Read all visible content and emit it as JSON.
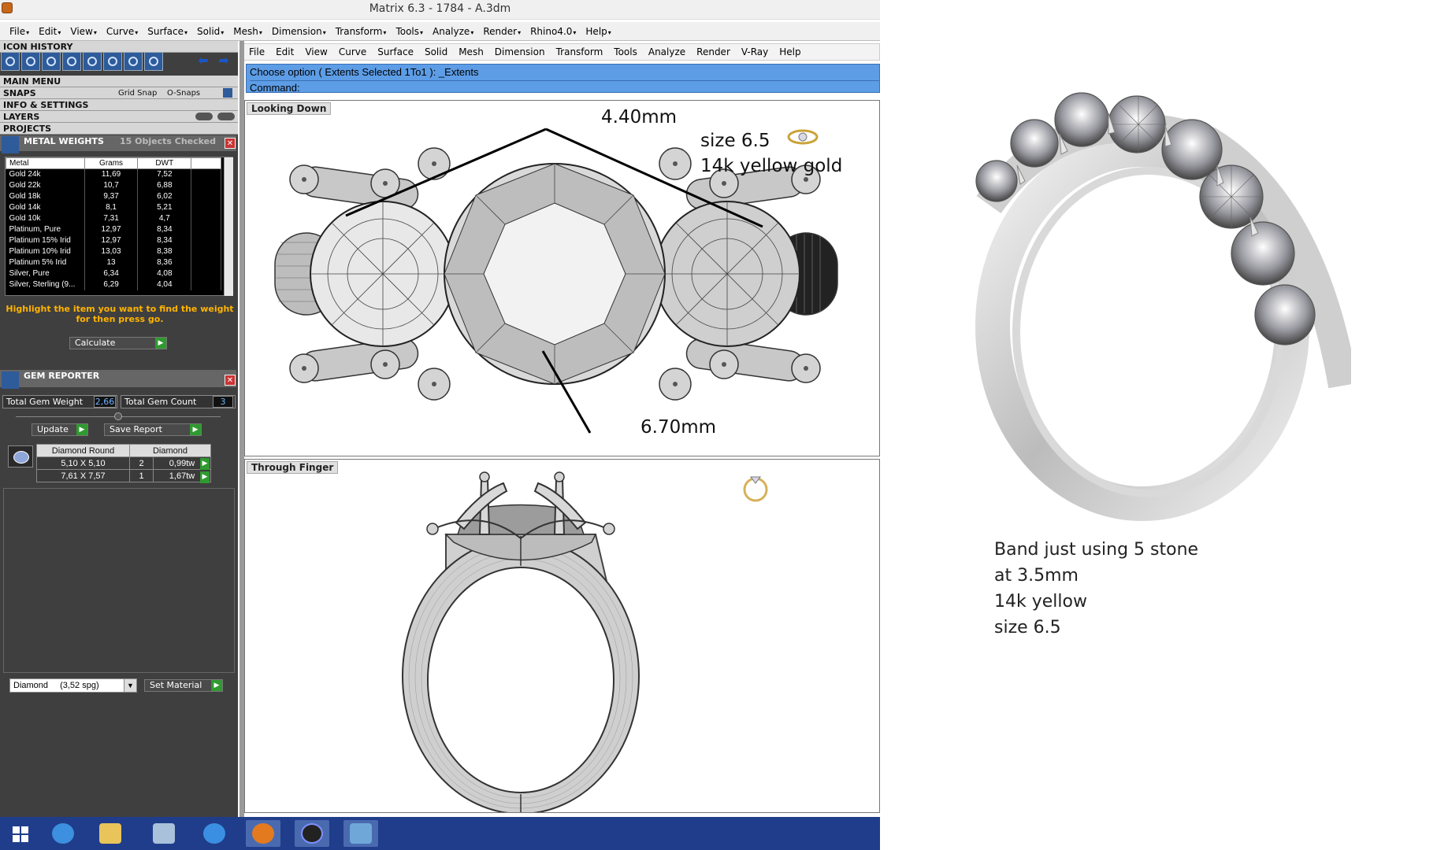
{
  "window": {
    "title": "Matrix 6.3 - 1784 - A.3dm"
  },
  "menubar": [
    "File",
    "Edit",
    "View",
    "Curve",
    "Surface",
    "Solid",
    "Mesh",
    "Dimension",
    "Transform",
    "Tools",
    "Analyze",
    "Render",
    "Rhino4.0",
    "Help"
  ],
  "sidebar": {
    "icon_history": "ICON HISTORY",
    "main_menu": "MAIN MENU",
    "snaps": "SNAPS",
    "grid_snap": "Grid Snap",
    "o_snaps": "O-Snaps",
    "info_settings": "INFO & SETTINGS",
    "layers": "LAYERS",
    "projects": "PROJECTS"
  },
  "metal_weights": {
    "title": "METAL WEIGHTS",
    "status": "15 Objects Checked",
    "columns": [
      "Metal",
      "Grams",
      "DWT"
    ],
    "rows": [
      [
        "Gold 24k",
        "11,69",
        "7,52"
      ],
      [
        "Gold 22k",
        "10,7",
        "6,88"
      ],
      [
        "Gold 18k",
        "9,37",
        "6,02"
      ],
      [
        "Gold 14k",
        "8,1",
        "5,21"
      ],
      [
        "Gold 10k",
        "7,31",
        "4,7"
      ],
      [
        "Platinum, Pure",
        "12,97",
        "8,34"
      ],
      [
        "Platinum 15% Irid",
        "12,97",
        "8,34"
      ],
      [
        "Platinum 10% Irid",
        "13,03",
        "8,38"
      ],
      [
        "Platinum 5% Irid",
        "13",
        "8,36"
      ],
      [
        "Silver, Pure",
        "6,34",
        "4,08"
      ],
      [
        "Silver, Sterling (9...",
        "6,29",
        "4,04"
      ]
    ],
    "hint": "Highlight the item you want to find the weight for then press go.",
    "calculate": "Calculate"
  },
  "gem_reporter": {
    "title": "GEM REPORTER",
    "total_weight_label": "Total Gem Weight",
    "total_weight": "2,66",
    "total_count_label": "Total Gem Count",
    "total_count": "3",
    "update": "Update",
    "save_report": "Save Report",
    "columns": [
      "Diamond Round",
      "Diamond"
    ],
    "rows": [
      [
        "5,10 X 5,10",
        "2",
        "0,99tw"
      ],
      [
        "7,61 X 7,57",
        "1",
        "1,67tw"
      ]
    ],
    "material": "Diamond",
    "material_sg": "(3,52 spg)",
    "set_material": "Set Material"
  },
  "inner_menu": [
    "File",
    "Edit",
    "View",
    "Curve",
    "Surface",
    "Solid",
    "Mesh",
    "Dimension",
    "Transform",
    "Tools",
    "Analyze",
    "Render",
    "V-Ray",
    "Help"
  ],
  "command": {
    "line1": "Choose option ( Extents  Selected  1To1 ): _Extents",
    "line2": "Command:"
  },
  "viewports": {
    "top": {
      "label": "Looking Down",
      "dim1": "4.40mm",
      "dim2": "6.70mm",
      "note1": "size 6.5",
      "note2": "14k yellow gold"
    },
    "bottom": {
      "label": "Through Finger"
    }
  },
  "ring_note": [
    "Band just using 5 stone",
    "at 3.5mm",
    "14k yellow",
    "size 6.5"
  ],
  "colors": {
    "accent": "#5d9de6",
    "panel": "#3f3f3f",
    "hint": "#ffb400",
    "taskbar": "#1f3d8a"
  }
}
